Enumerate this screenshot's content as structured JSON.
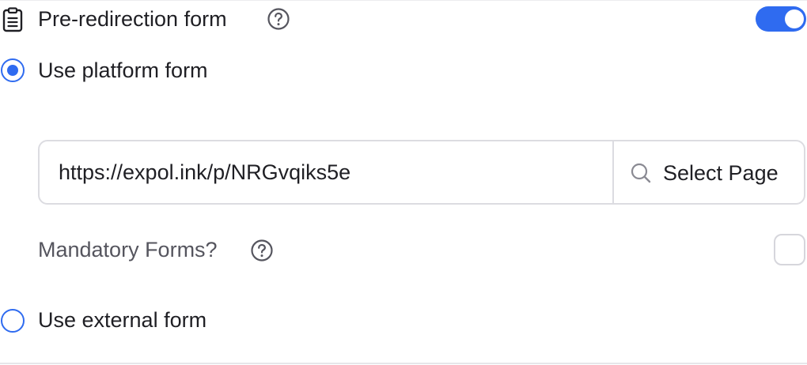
{
  "header": {
    "title": "Pre-redirection form",
    "icon": "clipboard-icon",
    "help_icon": "question-circle-icon",
    "toggle_on": true
  },
  "options": {
    "platform_form_label": "Use platform form",
    "platform_form_selected": true,
    "external_form_label": "Use external form",
    "external_form_selected": false
  },
  "url_field": {
    "value": "https://expol.ink/p/NRGvqiks5e",
    "select_page_label": "Select Page",
    "select_page_icon": "search-icon"
  },
  "mandatory": {
    "label": "Mandatory Forms?",
    "help_icon": "question-circle-icon",
    "checked": false
  },
  "colors": {
    "accent": "#2f6bf0",
    "text": "#1f1f24",
    "muted_text": "#55555e",
    "border": "#dcdce1"
  }
}
